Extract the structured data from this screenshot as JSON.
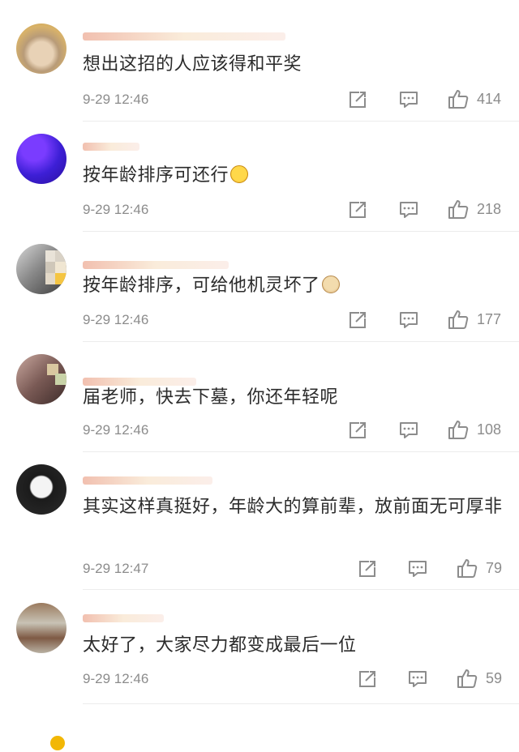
{
  "comments": [
    {
      "text": "想出这招的人应该得和平奖",
      "time": "9-29 12:46",
      "likes": "414",
      "emoji": ""
    },
    {
      "text": "按年龄排序可还行",
      "time": "9-29 12:46",
      "likes": "218",
      "emoji": "laugh-emoji"
    },
    {
      "text": "按年龄排序，可给他机灵坏了",
      "time": "9-29 12:46",
      "likes": "177",
      "emoji": "doge-emoji"
    },
    {
      "text": "届老师，快去下墓，你还年轻呢",
      "time": "9-29 12:46",
      "likes": "108",
      "emoji": ""
    },
    {
      "text": "其实这样真挺好，年龄大的算前辈，放前面无可厚非",
      "time": "9-29 12:47",
      "likes": "79",
      "emoji": ""
    },
    {
      "text": "太好了，大家尽力都变成最后一位",
      "time": "9-29 12:46",
      "likes": "59",
      "emoji": ""
    }
  ],
  "icons": {
    "repost": "share-icon",
    "comment": "comment-icon",
    "like": "thumbs-up-icon"
  },
  "colors": {
    "text": "#2b2b2b",
    "meta": "#8c8c8c",
    "icon": "#8c8c8c",
    "divider": "#ececec"
  }
}
